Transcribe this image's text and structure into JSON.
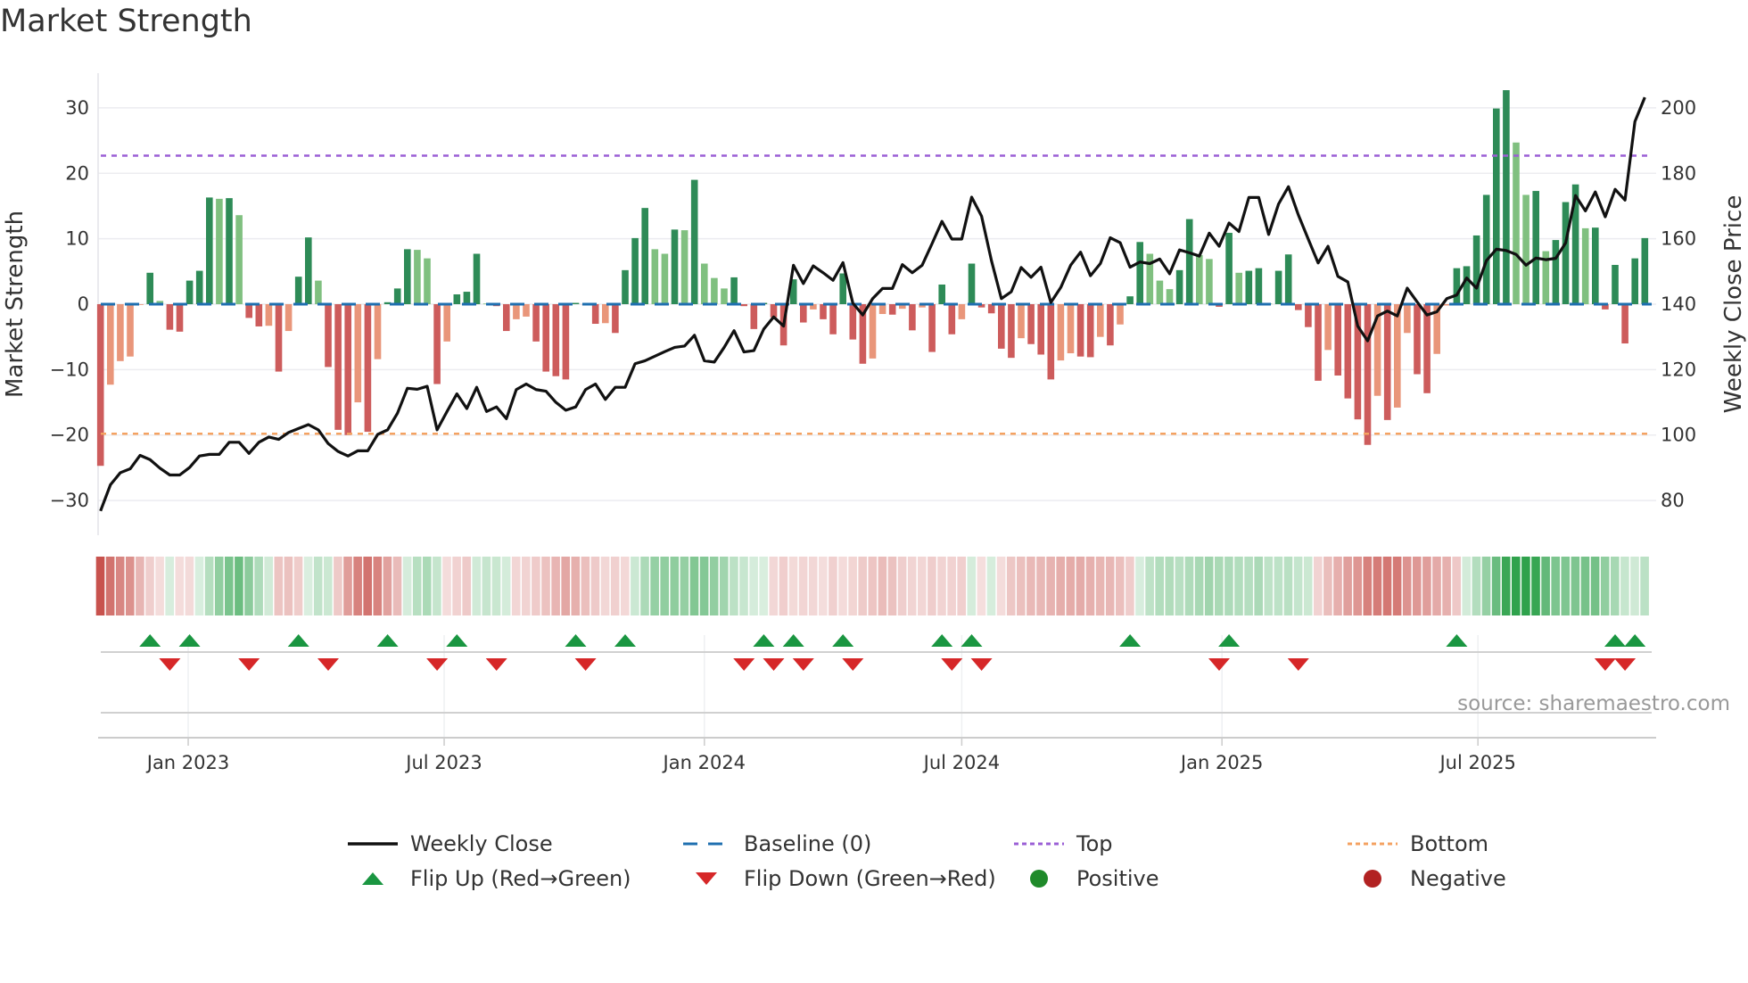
{
  "title": "Market Strength",
  "source": "source: sharemaestro.com",
  "legend": [
    {
      "label": "Weekly Close",
      "icon": "line-icon",
      "color": "#111111"
    },
    {
      "label": "Baseline (0)",
      "icon": "dashed-line-icon",
      "color": "#1f6fb0"
    },
    {
      "label": "Top",
      "icon": "dotted-line-icon",
      "color": "#9b5fd6"
    },
    {
      "label": "Bottom",
      "icon": "dotted-line-icon",
      "color": "#f4a261"
    },
    {
      "label": "Flip Up (Red→Green)",
      "icon": "triangle-up-icon",
      "color": "#1a9641"
    },
    {
      "label": "Flip Down (Green→Red)",
      "icon": "triangle-down-icon",
      "color": "#d62728"
    },
    {
      "label": "Positive",
      "icon": "circle-icon",
      "color": "#1f8a2a"
    },
    {
      "label": "Negative",
      "icon": "circle-icon",
      "color": "#b22222"
    }
  ],
  "colors": {
    "pos_strong": "#2e8b57",
    "pos_weak": "#80c080",
    "neg_strong": "#cd5c5c",
    "neg_weak": "#e9967a",
    "baseline": "#1f6fb0",
    "top": "#9b5fd6",
    "bottom": "#f4a261",
    "flip_up": "#1a9641",
    "flip_down": "#d62728",
    "price": "#111111"
  },
  "chart_data": {
    "type": "bar",
    "title": "Market Strength",
    "ylabel": "Market Strength",
    "y2label": "Weekly Close Price",
    "ylim": [
      -35.3,
      35.3
    ],
    "y2lim": [
      69.4,
      210.6
    ],
    "yticks": [
      -30,
      -20,
      -10,
      0,
      10,
      20,
      30
    ],
    "y2ticks": [
      80,
      100,
      120,
      140,
      160,
      180,
      200
    ],
    "yticklabels": [
      "−30",
      "−20",
      "−10",
      "0",
      "10",
      "20",
      "30"
    ],
    "y2ticklabels": [
      "80",
      "100",
      "120",
      "140",
      "160",
      "180",
      "200"
    ],
    "start_week": "2022-10-31",
    "xticks": [
      {
        "label": "Jan 2023",
        "date": "2023-01-01"
      },
      {
        "label": "Jul 2023",
        "date": "2023-07-01"
      },
      {
        "label": "Jan 2024",
        "date": "2024-01-01"
      },
      {
        "label": "Jul 2024",
        "date": "2024-07-01"
      },
      {
        "label": "Jan 2025",
        "date": "2025-01-01"
      },
      {
        "label": "Jul 2025",
        "date": "2025-07-01"
      }
    ],
    "top_level": 22.7,
    "bottom_level": -19.8,
    "baseline": 0,
    "strength": [
      -24.7,
      -12.3,
      -8.7,
      -8.0,
      -0.1,
      4.8,
      0.5,
      -3.9,
      -4.2,
      3.6,
      5.1,
      16.3,
      16.1,
      16.2,
      13.6,
      -2.1,
      -3.4,
      -3.3,
      -10.3,
      -4.1,
      4.2,
      10.2,
      3.6,
      -9.6,
      -19.2,
      -20.0,
      -15.0,
      -19.5,
      -8.4,
      0.3,
      2.4,
      8.4,
      8.3,
      7.0,
      -12.2,
      -5.7,
      1.5,
      1.9,
      7.7,
      0.1,
      -0.3,
      -4.1,
      -2.3,
      -1.9,
      -5.7,
      -10.3,
      -11.0,
      -11.5,
      0.2,
      -0.2,
      -3.0,
      -2.9,
      -4.4,
      5.2,
      10.1,
      14.7,
      8.4,
      7.7,
      11.4,
      11.3,
      19.0,
      6.2,
      4.0,
      2.4,
      4.1,
      -0.3,
      -3.8,
      0.2,
      -2.0,
      -6.3,
      3.8,
      -2.8,
      -0.8,
      -2.3,
      -4.6,
      4.7,
      -5.4,
      -9.1,
      -8.3,
      -1.5,
      -1.6,
      -0.7,
      -4.0,
      -0.5,
      -7.3,
      3.0,
      -4.6,
      -2.3,
      6.2,
      -0.5,
      -1.4,
      -6.8,
      -8.2,
      -5.2,
      -6.1,
      -7.7,
      -11.5,
      -8.6,
      -7.5,
      -8.0,
      -8.1,
      -5.0,
      -6.3,
      -3.1,
      1.2,
      9.5,
      7.7,
      3.6,
      2.3,
      5.2,
      13.0,
      7.5,
      6.9,
      -0.4,
      10.9,
      4.8,
      5.1,
      5.5,
      0.1,
      5.1,
      7.6,
      -0.9,
      -3.5,
      -11.7,
      -7.0,
      -10.9,
      -14.4,
      -17.6,
      -21.5,
      -14.0,
      -17.7,
      -15.8,
      -4.4,
      -10.7,
      -13.6,
      -7.6,
      -0.2,
      5.5,
      5.8,
      10.5,
      16.7,
      29.9,
      32.7,
      24.7,
      16.7,
      17.3,
      8.1,
      9.8,
      15.6,
      18.3,
      11.6,
      11.7,
      -0.8,
      6.0,
      -6.0,
      7.0,
      10.1
    ],
    "weekly_close": [
      76.8,
      84.8,
      88.5,
      89.7,
      93.8,
      92.5,
      89.9,
      87.8,
      87.8,
      90.1,
      93.6,
      94.1,
      94.1,
      97.8,
      97.8,
      94.4,
      97.8,
      99.4,
      98.7,
      100.8,
      102.0,
      103.2,
      101.6,
      97.4,
      95.0,
      93.6,
      95.2,
      95.2,
      100.2,
      101.6,
      106.7,
      114.3,
      114.0,
      114.9,
      101.6,
      107.2,
      112.6,
      108.1,
      114.6,
      107.2,
      108.6,
      105.0,
      113.9,
      115.6,
      113.9,
      113.4,
      110.0,
      107.6,
      108.6,
      113.9,
      115.6,
      110.9,
      114.6,
      114.6,
      121.8,
      122.7,
      124.1,
      125.5,
      126.8,
      127.2,
      130.5,
      122.7,
      122.3,
      126.8,
      131.9,
      125.4,
      125.8,
      132.4,
      136.1,
      133.3,
      151.9,
      146.3,
      151.7,
      149.6,
      147.3,
      152.7,
      140.3,
      136.7,
      141.7,
      144.8,
      144.8,
      152.1,
      149.6,
      151.9,
      158.5,
      165.3,
      159.9,
      159.9,
      172.7,
      166.9,
      153.3,
      141.7,
      143.8,
      151.2,
      148.2,
      151.3,
      140.5,
      145.1,
      151.9,
      155.9,
      148.7,
      152.4,
      160.3,
      158.8,
      151.3,
      152.9,
      152.4,
      153.8,
      149.3,
      156.6,
      155.7,
      154.7,
      161.7,
      157.7,
      164.8,
      162.2,
      172.6,
      172.6,
      161.3,
      170.6,
      175.9,
      167.3,
      159.9,
      152.6,
      157.7,
      148.5,
      146.8,
      133.3,
      128.8,
      136.4,
      137.9,
      136.4,
      144.9,
      140.7,
      136.7,
      137.7,
      141.7,
      142.8,
      148.0,
      144.9,
      153.3,
      156.8,
      156.4,
      155.2,
      151.9,
      154.1,
      153.6,
      154.0,
      158.7,
      173.2,
      168.5,
      174.3,
      166.7,
      175.1,
      171.8,
      195.8,
      203.2
    ]
  }
}
